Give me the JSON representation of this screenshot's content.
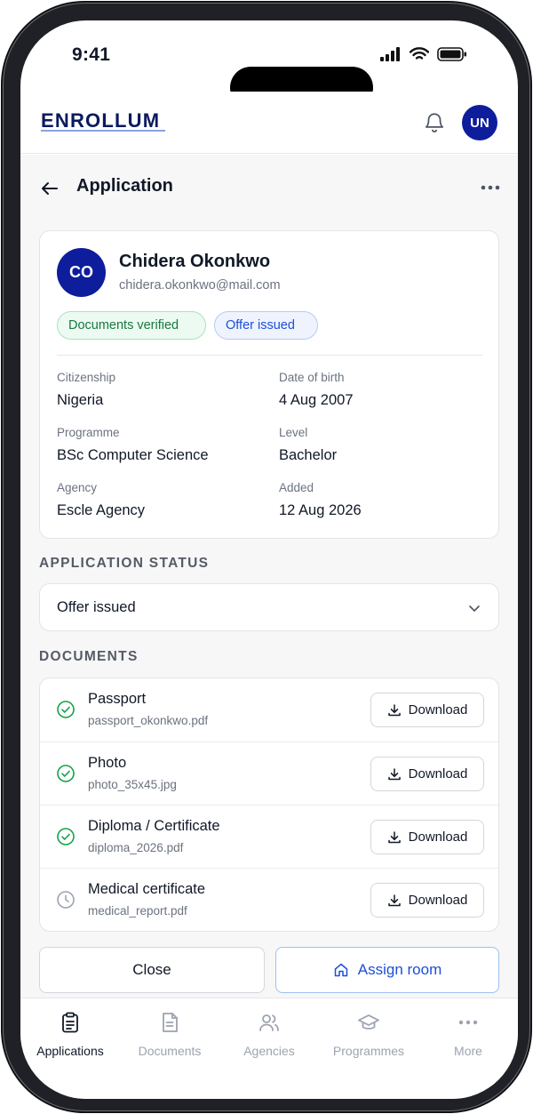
{
  "status_bar": {
    "time": "9:41"
  },
  "header": {
    "logo_text": "ENROLLUM",
    "user_initials": "UN"
  },
  "page": {
    "title": "Application"
  },
  "applicant": {
    "initials": "CO",
    "name": "Chidera Okonkwo",
    "email": "chidera.okonkwo@mail.com",
    "badges": [
      {
        "label": "Documents verified",
        "tone": "green"
      },
      {
        "label": "Offer issued",
        "tone": "blue"
      }
    ],
    "fields": [
      {
        "label": "Citizenship",
        "value": "Nigeria"
      },
      {
        "label": "Date of birth",
        "value": "4 Aug 2007"
      },
      {
        "label": "Programme",
        "value": "BSc Computer Science"
      },
      {
        "label": "Level",
        "value": "Bachelor"
      },
      {
        "label": "Agency",
        "value": "Escle Agency"
      },
      {
        "label": "Added",
        "value": "12 Aug 2026"
      }
    ]
  },
  "application_status": {
    "section_label": "APPLICATION STATUS",
    "selected": "Offer issued"
  },
  "documents": {
    "section_label": "DOCUMENTS",
    "download_label": "Download",
    "items": [
      {
        "name": "Passport",
        "file": "passport_okonkwo.pdf",
        "state": "verified",
        "icon": "check-circle-icon"
      },
      {
        "name": "Photo",
        "file": "photo_35x45.jpg",
        "state": "verified",
        "icon": "check-circle-icon"
      },
      {
        "name": "Diploma / Certificate",
        "file": "diploma_2026.pdf",
        "state": "verified",
        "icon": "check-circle-icon"
      },
      {
        "name": "Medical certificate",
        "file": "medical_report.pdf",
        "state": "pending",
        "icon": "clock-icon"
      }
    ]
  },
  "actions": {
    "close_label": "Close",
    "assign_label": "Assign room"
  },
  "bottom_nav": [
    {
      "label": "Applications",
      "icon": "clipboard-icon",
      "active": true
    },
    {
      "label": "Documents",
      "icon": "document-icon",
      "active": false
    },
    {
      "label": "Agencies",
      "icon": "users-icon",
      "active": false
    },
    {
      "label": "Programmes",
      "icon": "graduation-cap-icon",
      "active": false
    },
    {
      "label": "More",
      "icon": "more-dots-icon",
      "active": false
    }
  ],
  "colors": {
    "brand": "#0d1d9c",
    "accent": "#1d4ed8",
    "success": "#16a34a",
    "muted": "#6b7280"
  }
}
